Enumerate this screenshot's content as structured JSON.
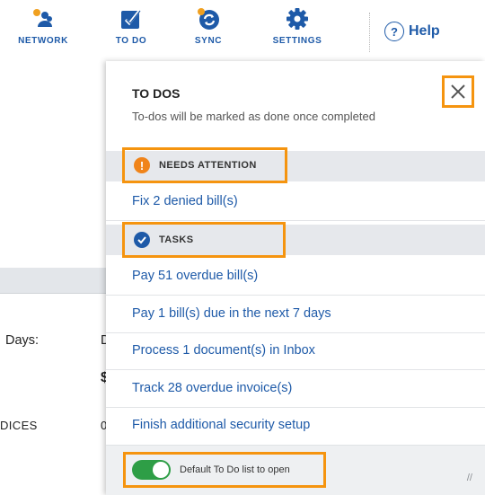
{
  "nav": {
    "items": [
      {
        "label": "NETWORK",
        "icon": "network-icon"
      },
      {
        "label": "TO DO",
        "icon": "todo-check-icon"
      },
      {
        "label": "SYNC",
        "icon": "sync-icon"
      },
      {
        "label": "SETTINGS",
        "icon": "gear-icon"
      }
    ],
    "help_label": "Help",
    "help_icon_glyph": "?"
  },
  "background": {
    "label_days": "Days:",
    "char_d": "D",
    "char_dollar": "$",
    "label_invoices": "DICES",
    "char_zero": "0"
  },
  "todo_panel": {
    "title": "TO DOS",
    "subtitle": "To-dos will be marked as done once completed",
    "close_icon": "close-icon",
    "needs_attention": {
      "label": "NEEDS ATTENTION",
      "icon_glyph": "!",
      "items": [
        "Fix 2 denied bill(s)"
      ]
    },
    "tasks": {
      "label": "TASKS",
      "items": [
        "Pay 51 overdue bill(s)",
        "Pay 1 bill(s) due in the next 7 days",
        "Process 1 document(s) in Inbox",
        "Track 28 overdue invoice(s)",
        "Finish additional security setup"
      ]
    },
    "footer": {
      "toggle_label": "Default To Do list to open",
      "toggle_on": true,
      "resize_glyph": "//"
    }
  },
  "colors": {
    "brand_blue": "#1e5aa8",
    "accent_orange": "#f5940f",
    "warning_orange": "#f0841a",
    "toggle_green": "#2e9e46"
  }
}
